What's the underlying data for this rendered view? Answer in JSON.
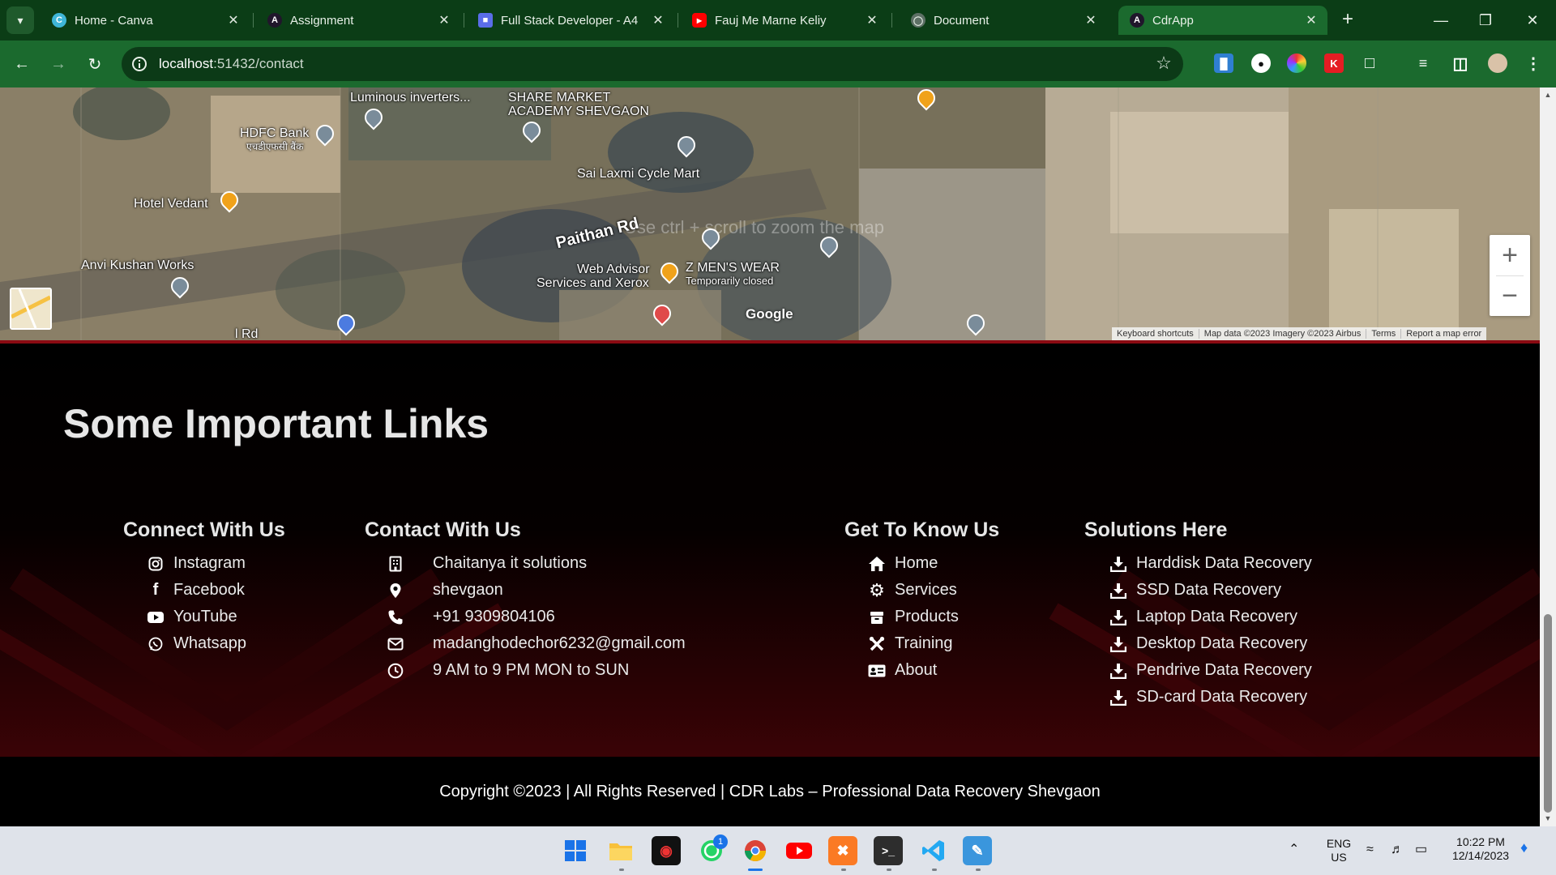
{
  "browser": {
    "tabs": [
      {
        "title": "Home - Canva",
        "icon": "canva-icon",
        "active": false
      },
      {
        "title": "Assignment",
        "icon": "angular-icon",
        "active": false
      },
      {
        "title": "Full Stack Developer - A4",
        "icon": "docs-icon",
        "active": false
      },
      {
        "title": "Fauj Me Marne Keliy",
        "icon": "youtube-icon",
        "active": false
      },
      {
        "title": "Document",
        "icon": "globe-icon",
        "active": false
      },
      {
        "title": "CdrApp",
        "icon": "angular-icon",
        "active": true
      }
    ],
    "url_host": "localhost",
    "url_path": ":51432/contact"
  },
  "map": {
    "labels": {
      "luminous": "Luminous inverters...",
      "share_market_1": "SHARE MARKET",
      "share_market_2": "ACADEMY SHEVGAON",
      "hdfc": "HDFC Bank",
      "hdfc_sub": "एचडीएफसी बैंक",
      "sai_laxmi": "Sai Laxmi Cycle Mart",
      "hotel": "Hotel Vedant",
      "paithan": "Paithan Rd",
      "anvi": "Anvi Kushan Works",
      "web_advisor_1": "Web Advisor",
      "web_advisor_2": "Services and Xerox",
      "zmens": "Z MEN'S WEAR",
      "zmens_sub": "Temporarily closed",
      "road_partial": "l Rd",
      "ghost": "Use ctrl + scroll to zoom the map",
      "google": "Google"
    },
    "footer_links": [
      "Keyboard shortcuts",
      "Map data ©2023 Imagery ©2023 Airbus",
      "Terms",
      "Report a map error"
    ],
    "zoom_in": "+",
    "zoom_out": "−"
  },
  "footer": {
    "heading": "Some Important Links",
    "connect": {
      "title": "Connect With Us",
      "items": [
        {
          "label": "Instagram",
          "icon": "instagram-icon"
        },
        {
          "label": "Facebook",
          "icon": "facebook-icon"
        },
        {
          "label": "YouTube",
          "icon": "youtube-icon"
        },
        {
          "label": "Whatsapp",
          "icon": "whatsapp-icon"
        }
      ]
    },
    "contact": {
      "title": "Contact With Us",
      "items": [
        {
          "label": "Chaitanya it solutions",
          "icon": "building-icon"
        },
        {
          "label": "shevgaon",
          "icon": "location-pin-icon"
        },
        {
          "label": "+91 9309804106",
          "icon": "phone-icon"
        },
        {
          "label": "madanghodechor6232@gmail.com",
          "icon": "envelope-icon"
        },
        {
          "label": "9 AM to 9 PM MON to SUN",
          "icon": "clock-icon"
        }
      ]
    },
    "know": {
      "title": "Get To Know Us",
      "items": [
        {
          "label": "Home",
          "icon": "home-icon"
        },
        {
          "label": "Services",
          "icon": "gear-icon"
        },
        {
          "label": "Products",
          "icon": "box-icon"
        },
        {
          "label": "Training",
          "icon": "tools-icon"
        },
        {
          "label": "About",
          "icon": "id-card-icon"
        }
      ]
    },
    "solutions": {
      "title": "Solutions Here",
      "items": [
        {
          "label": "Harddisk Data Recovery",
          "icon": "download-icon"
        },
        {
          "label": "SSD Data Recovery",
          "icon": "download-icon"
        },
        {
          "label": "Laptop Data Recovery",
          "icon": "download-icon"
        },
        {
          "label": "Desktop Data Recovery",
          "icon": "download-icon"
        },
        {
          "label": "Pendrive Data Recovery",
          "icon": "download-icon"
        },
        {
          "label": "SD-card Data Recovery",
          "icon": "download-icon"
        }
      ]
    },
    "copyright": "Copyright ©2023 | All Rights Reserved | CDR Labs – Professional Data Recovery Shevgaon"
  },
  "taskbar": {
    "apps": [
      "start-icon",
      "file-explorer-icon",
      "screen-recorder-icon",
      "whatsapp-icon",
      "chrome-icon",
      "youtube-icon",
      "xampp-icon",
      "terminal-icon",
      "vscode-icon",
      "paint-icon"
    ],
    "whatsapp_badge": "1",
    "lang_1": "ENG",
    "lang_2": "US",
    "time": "10:22 PM",
    "date": "12/14/2023"
  },
  "colors": {
    "chrome_dark": "#0b3d16",
    "chrome_mid": "#1b6a2e",
    "footer_accent": "#8a0a12"
  }
}
